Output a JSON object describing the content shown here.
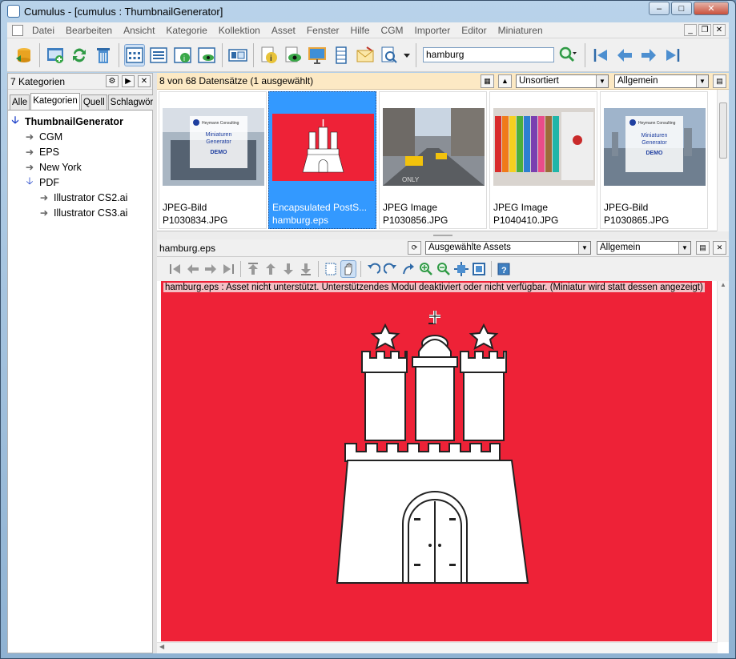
{
  "window": {
    "title": "Cumulus - [cumulus : ThumbnailGenerator]"
  },
  "menu": [
    "Datei",
    "Bearbeiten",
    "Ansicht",
    "Kategorie",
    "Kollektion",
    "Asset",
    "Fenster",
    "Hilfe",
    "CGM",
    "Importer",
    "Editor",
    "Miniaturen"
  ],
  "toolbar": {
    "search_value": "hamburg"
  },
  "sidebar": {
    "header": "7 Kategorien",
    "tabs": [
      "Alle",
      "Kategorien",
      "Quell",
      "Schlagwörte"
    ],
    "tree": [
      {
        "label": "ThumbnailGenerator"
      },
      {
        "label": "CGM"
      },
      {
        "label": "EPS"
      },
      {
        "label": "New York"
      },
      {
        "label": "PDF"
      },
      {
        "label": "Illustrator CS2.ai"
      },
      {
        "label": "Illustrator CS3.ai"
      }
    ]
  },
  "results": {
    "status": "8 von 68 Datensätze (1 ausgewählt)",
    "sort": "Unsortiert",
    "view": "Allgemein"
  },
  "thumbnails": [
    {
      "type": "JPEG-Bild",
      "name": "P1030834.JPG"
    },
    {
      "type": "Encapsulated PostS...",
      "name": "hamburg.eps"
    },
    {
      "type": "JPEG Image",
      "name": "P1030856.JPG"
    },
    {
      "type": "JPEG Image",
      "name": "P1040410.JPG"
    },
    {
      "type": "JPEG-Bild",
      "name": "P1030865.JPG"
    }
  ],
  "demo_card": {
    "company": "Heymann Consulting",
    "title1": "Miniaturen",
    "title2": "Generator",
    "badge": "DEMO"
  },
  "preview": {
    "filename": "hamburg.eps",
    "assets_select": "Ausgewählte Assets",
    "view_select": "Allgemein",
    "message": "hamburg.eps : Asset nicht unterstützt. Unterstützendes Modul deaktiviert oder nicht verfügbar. (Miniatur wird statt dessen angezeigt)"
  },
  "colors": {
    "flag_red": "#ee2237",
    "selection": "#3399ff",
    "status_bar": "#fce9c4"
  }
}
